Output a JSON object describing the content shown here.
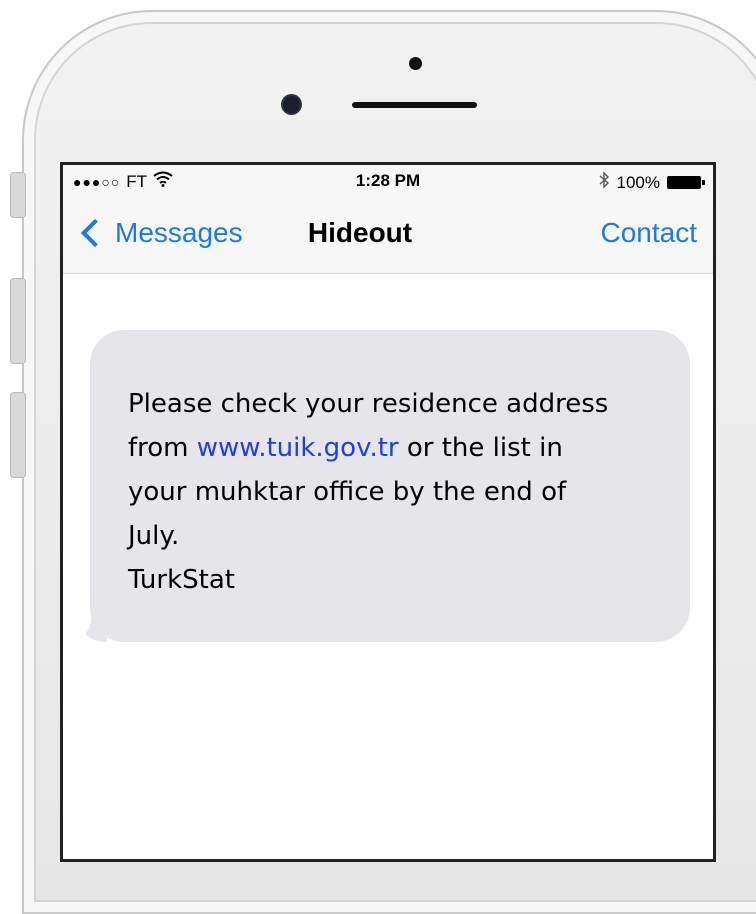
{
  "status_bar": {
    "carrier": "FT",
    "time": "1:28 PM",
    "battery": "100%"
  },
  "nav": {
    "back_label": "Messages",
    "title": "Hideout",
    "contact_label": "Contact"
  },
  "message": {
    "line1": "Please check your residence address",
    "from": "from",
    "link": "www.tuik.gov.tr",
    "line2_rest": "or the list in",
    "line3": "your muhktar office by the end of",
    "line4": "July.",
    "sender": "TurkStat"
  },
  "colors": {
    "accent": "#1a7ae8",
    "bubble": "#e5e5ea",
    "link": "#1f3fe0"
  }
}
